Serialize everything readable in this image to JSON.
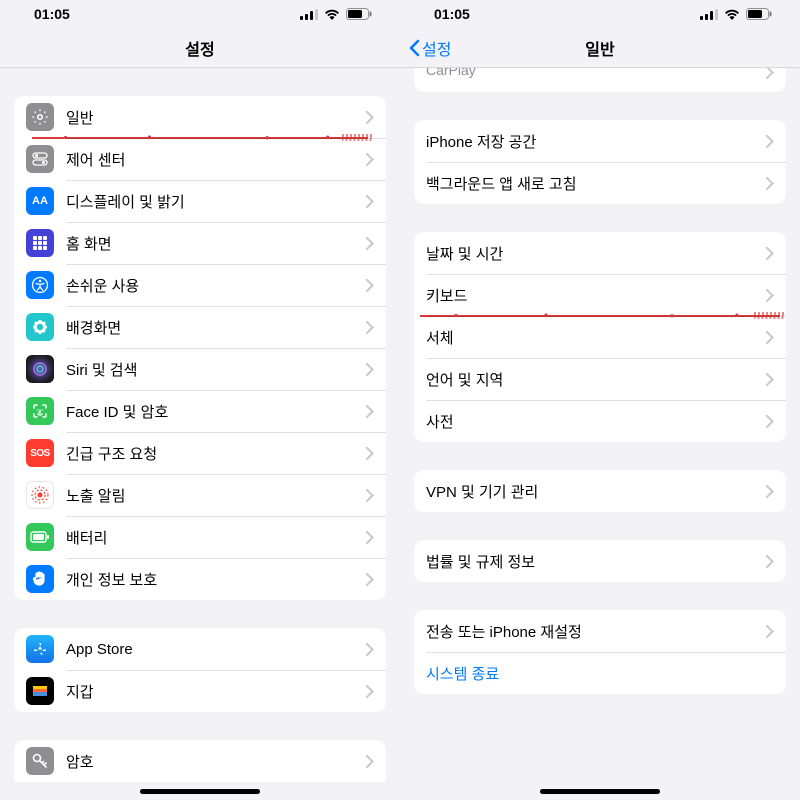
{
  "status": {
    "time": "01:05"
  },
  "left": {
    "title": "설정",
    "group1": [
      {
        "label": "일반",
        "icon": "gear",
        "bg": "#8e8e93",
        "highlight": true
      },
      {
        "label": "제어 센터",
        "icon": "toggles",
        "bg": "#8e8e93"
      },
      {
        "label": "디스플레이 및 밝기",
        "icon": "AA",
        "bg": "#007aff",
        "text": true
      },
      {
        "label": "홈 화면",
        "icon": "grid",
        "bg": "#3b3bd6"
      },
      {
        "label": "손쉬운 사용",
        "icon": "accessibility",
        "bg": "#007aff"
      },
      {
        "label": "배경화면",
        "icon": "flower",
        "bg": "#23c2c7"
      },
      {
        "label": "Siri 및 검색",
        "icon": "siri",
        "bg": "#1c1c1e"
      },
      {
        "label": "Face ID 및 암호",
        "icon": "faceid",
        "bg": "#34c759"
      },
      {
        "label": "긴급 구조 요청",
        "icon": "SOS",
        "bg": "#ff3b30",
        "text": true
      },
      {
        "label": "노출 알림",
        "icon": "exposure",
        "bg": "#ffffff"
      },
      {
        "label": "배터리",
        "icon": "battery",
        "bg": "#34c759"
      },
      {
        "label": "개인 정보 보호",
        "icon": "hand",
        "bg": "#007aff"
      }
    ],
    "group2": [
      {
        "label": "App Store",
        "icon": "appstore",
        "bg": "#1e90ff"
      },
      {
        "label": "지갑",
        "icon": "wallet",
        "bg": "#000000"
      }
    ],
    "group3": [
      {
        "label": "암호",
        "icon": "key",
        "bg": "#8e8e93"
      }
    ]
  },
  "right": {
    "back": "설정",
    "title": "일반",
    "pre": {
      "label": "CarPlay"
    },
    "group_a": [
      {
        "label": "iPhone 저장 공간"
      },
      {
        "label": "백그라운드 앱 새로 고침"
      }
    ],
    "group_b": [
      {
        "label": "날짜 및 시간"
      },
      {
        "label": "키보드",
        "highlight": true
      },
      {
        "label": "서체"
      },
      {
        "label": "언어 및 지역"
      },
      {
        "label": "사전"
      }
    ],
    "group_c": [
      {
        "label": "VPN 및 기기 관리"
      }
    ],
    "group_d": [
      {
        "label": "법률 및 규제 정보"
      }
    ],
    "group_e": [
      {
        "label": "전송 또는 iPhone 재설정"
      },
      {
        "label": "시스템 종료",
        "link": true,
        "nochev": true
      }
    ]
  }
}
